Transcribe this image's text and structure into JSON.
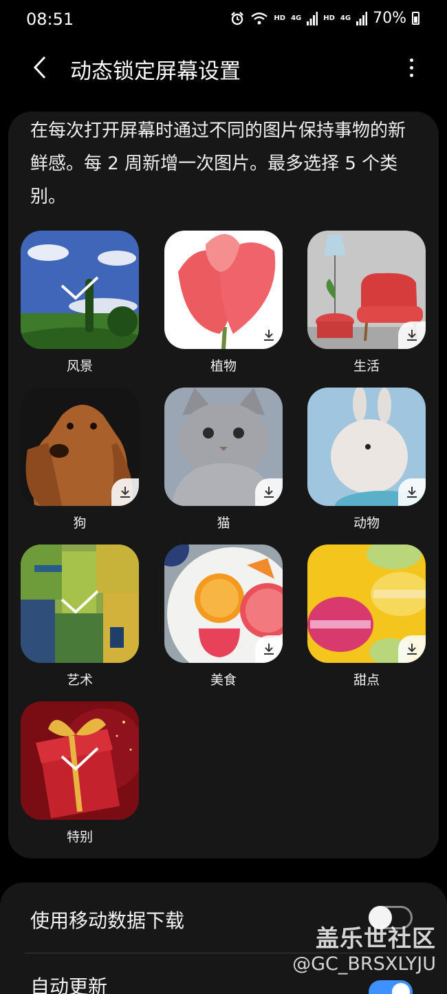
{
  "status_bar": {
    "time": "08:51",
    "hd_label": "HD",
    "network_label": "4G",
    "battery": "70%",
    "icons": [
      "alarm-icon",
      "wifi-icon",
      "signal-icon",
      "battery-icon"
    ]
  },
  "header": {
    "title": "动态锁定屏幕设置",
    "icons": [
      "back-arrow-icon",
      "more-options-icon"
    ]
  },
  "description": "在每次打开屏幕时通过不同的图片保持事物的新鲜感。每 2 周新增一次图片。最多选择 5 个类别。",
  "categories": [
    {
      "label": "风景",
      "state": "selected"
    },
    {
      "label": "植物",
      "state": "download"
    },
    {
      "label": "生活",
      "state": "download"
    },
    {
      "label": "狗",
      "state": "download"
    },
    {
      "label": "猫",
      "state": "download"
    },
    {
      "label": "动物",
      "state": "download"
    },
    {
      "label": "艺术",
      "state": "selected"
    },
    {
      "label": "美食",
      "state": "download"
    },
    {
      "label": "甜点",
      "state": "download"
    },
    {
      "label": "特别",
      "state": "selected"
    }
  ],
  "settings": {
    "mobile_data": {
      "label": "使用移动数据下载",
      "enabled": false
    },
    "auto_update": {
      "label": "自动更新",
      "enabled": true
    }
  },
  "watermark": {
    "title": "盖乐世社区",
    "handle": "@GC_BRSXLYJU"
  },
  "colors": {
    "background": "#000000",
    "card": "#171717",
    "accent": "#3e91ff"
  }
}
